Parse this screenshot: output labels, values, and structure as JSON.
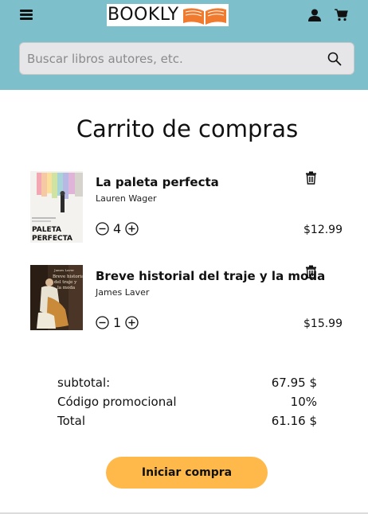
{
  "header": {
    "logo_text": "BOOKLY",
    "icons": [
      "hamburger-icon",
      "book-logo-icon",
      "user-icon",
      "cart-icon"
    ],
    "background_color": "#7dbfcb"
  },
  "search": {
    "placeholder": "Buscar libros autores, etc.",
    "value": "",
    "icon": "search-icon"
  },
  "page": {
    "title": "Carrito de compras"
  },
  "cart": {
    "items": [
      {
        "title": "La paleta perfecta",
        "author": "Lauren Wager",
        "quantity": "4",
        "price": "$12.99",
        "cover_text": "PALETA PERFECTA"
      },
      {
        "title": "Breve historial del traje y la moda",
        "author": "James Laver",
        "quantity": "1",
        "price": "$15.99",
        "cover_text": "Breve historia del traje y la moda"
      }
    ]
  },
  "summary": {
    "subtotal_label": "subtotal:",
    "subtotal_value": "67.95 $",
    "promo_label": "Código promocional",
    "promo_value": "10%",
    "total_label": "Total",
    "total_value": "61.16 $"
  },
  "actions": {
    "checkout_label": "Iniciar compra",
    "checkout_color": "#ffb94a"
  }
}
